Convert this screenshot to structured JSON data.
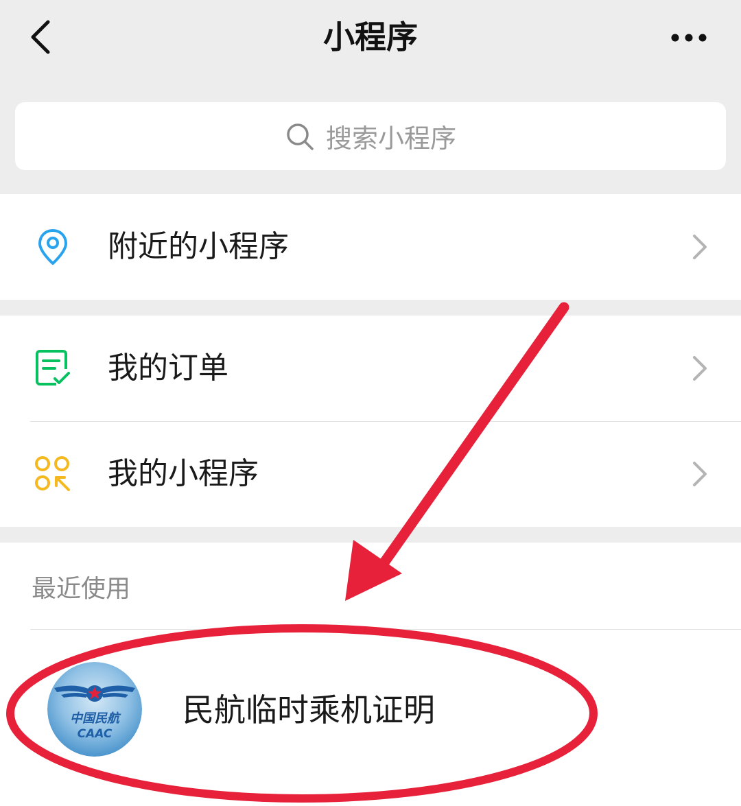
{
  "nav": {
    "title": "小程序",
    "back_icon": "chevron-left-icon",
    "more_icon": "more-dots-icon"
  },
  "search": {
    "placeholder": "搜索小程序",
    "icon": "search-icon"
  },
  "menu_groups": [
    {
      "items": [
        {
          "label": "附近的小程序",
          "icon": "location-pin-icon",
          "icon_color": "#2aa3ef"
        }
      ]
    },
    {
      "items": [
        {
          "label": "我的订单",
          "icon": "order-checklist-icon",
          "icon_color": "#07c160"
        },
        {
          "label": "我的小程序",
          "icon": "my-miniprogram-icon",
          "icon_color": "#f5b81f"
        }
      ]
    }
  ],
  "recent": {
    "section_label": "最近使用",
    "items": [
      {
        "name": "民航临时乘机证明",
        "logo_text_cn": "中国民航",
        "logo_text_en": "CAAC"
      }
    ]
  },
  "annotation": {
    "color": "#e8213a",
    "shapes": [
      "arrow",
      "ellipse"
    ]
  }
}
